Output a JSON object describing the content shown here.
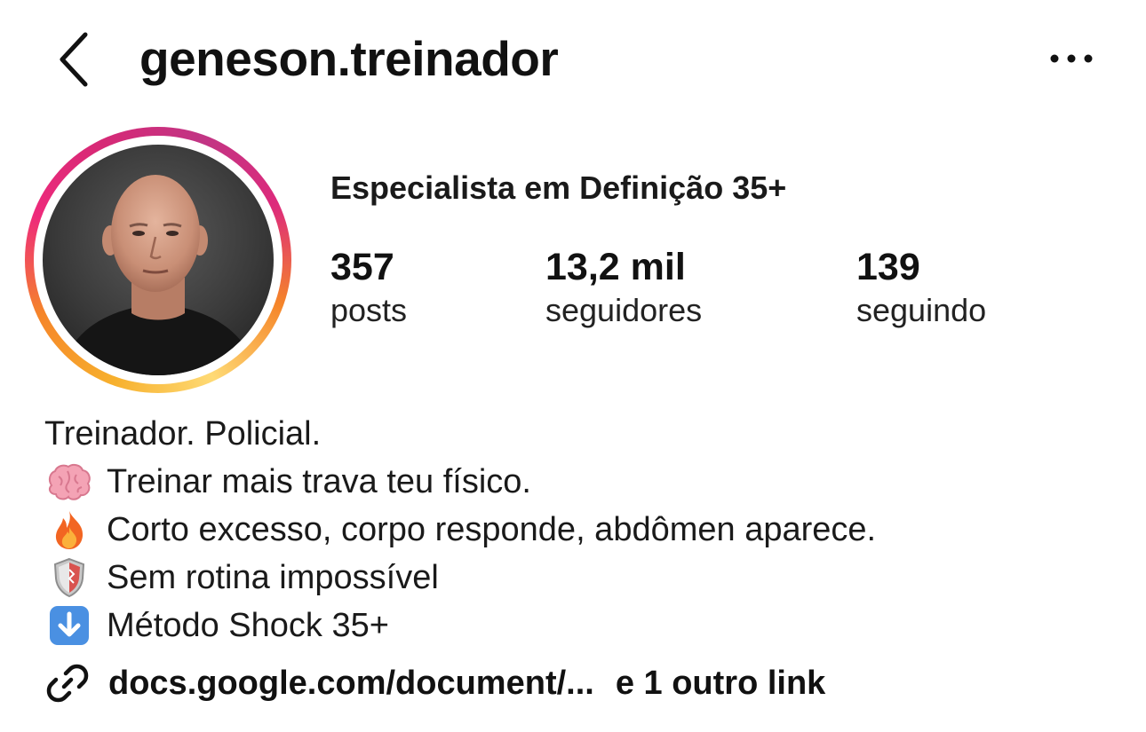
{
  "header": {
    "username": "geneson.treinador",
    "back_icon": "chevron-left-icon",
    "more_icon": "ellipsis-horizontal-icon"
  },
  "profile": {
    "category": "Especialista em Definição 35+",
    "avatar_ring_colors": [
      "#feda75",
      "#f58529",
      "#dd2a7b",
      "#c13584"
    ]
  },
  "stats": {
    "posts": {
      "value": "357",
      "label": "posts"
    },
    "followers": {
      "value": "13,2 mil",
      "label": "seguidores"
    },
    "following": {
      "value": "139",
      "label": "seguindo"
    }
  },
  "bio": {
    "line1": "Treinador. Policial.",
    "line2": "Treinar mais trava teu físico.",
    "line3": "Corto excesso, corpo responde, abdômen aparece.",
    "line4": "Sem rotina impossível",
    "line5": "Método Shock 35+",
    "icons": [
      "brain-icon",
      "fire-icon",
      "shield-icon",
      "arrow-down-icon"
    ]
  },
  "link": {
    "icon": "link-icon",
    "url_text": "docs.google.com/document/...",
    "more_text": "e 1 outro link"
  }
}
